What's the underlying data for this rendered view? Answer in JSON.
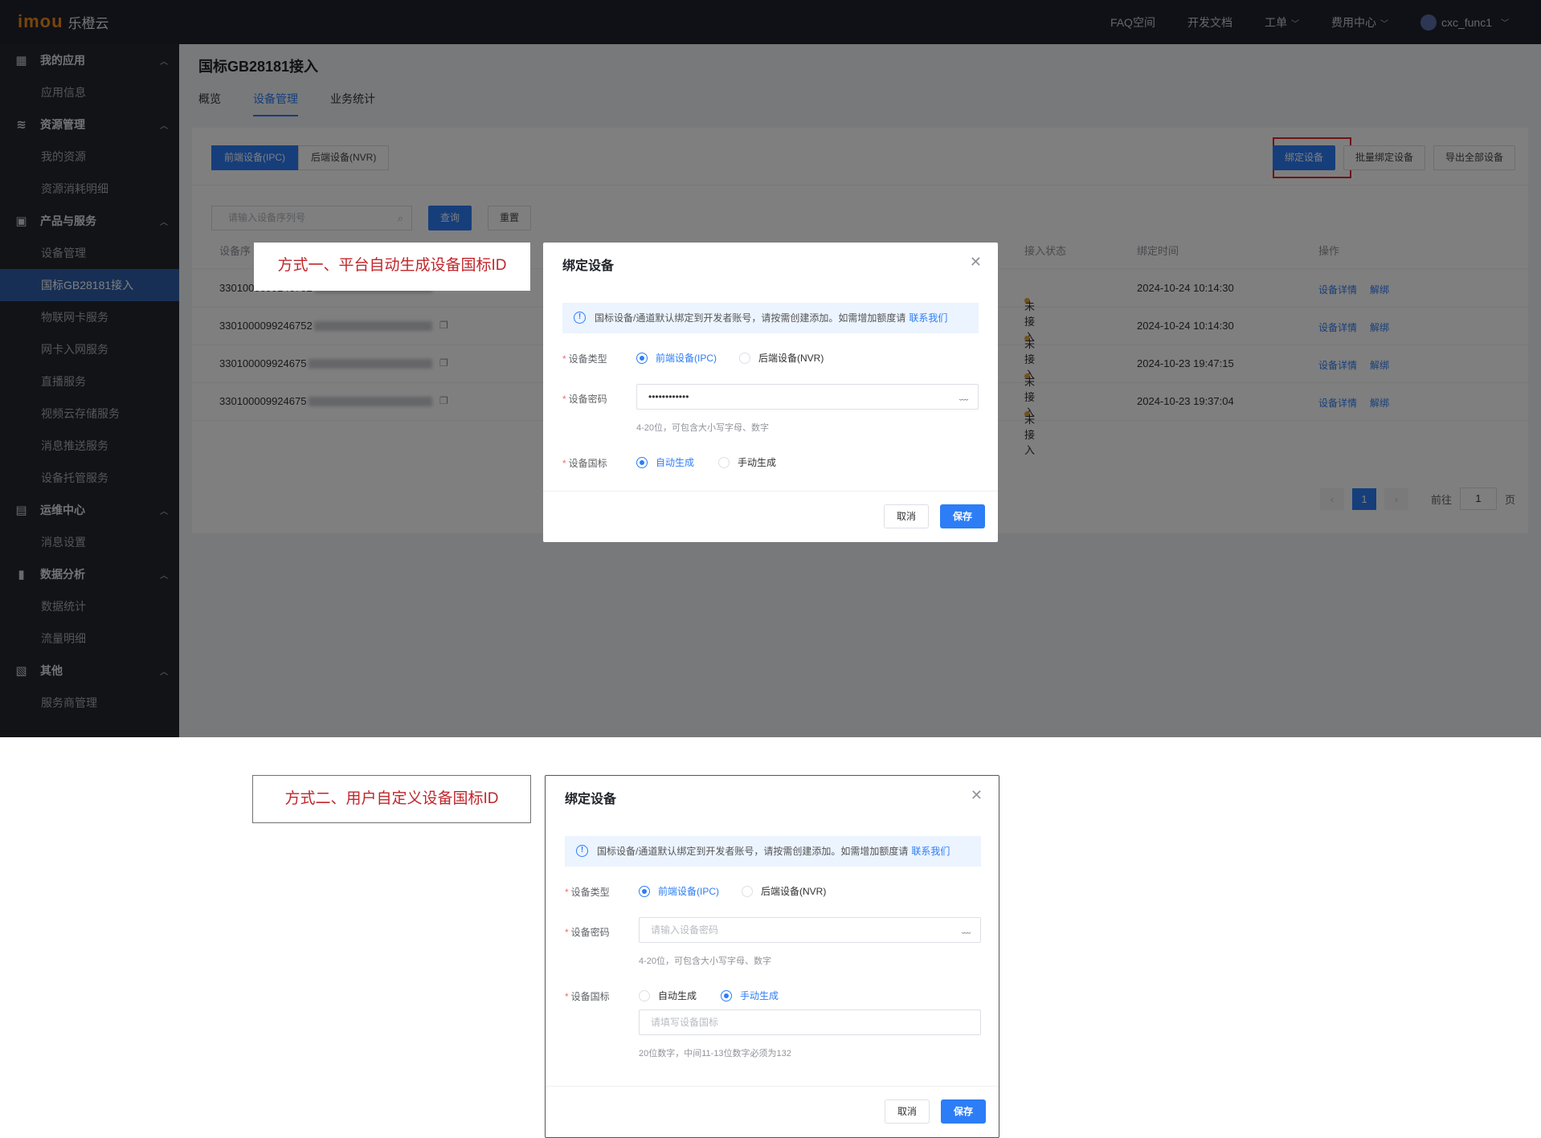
{
  "topbar": {
    "logo_mark": "imou",
    "logo_text": "乐橙云",
    "nav": [
      "FAQ空间",
      "开发文档",
      "工单",
      "费用中心"
    ],
    "username": "cxc_func1"
  },
  "sidebar": {
    "groups": [
      {
        "label": "我的应用",
        "icon": "grid-icon",
        "items": [
          "应用信息"
        ]
      },
      {
        "label": "资源管理",
        "icon": "layers-icon",
        "items": [
          "我的资源",
          "资源消耗明细"
        ]
      },
      {
        "label": "产品与服务",
        "icon": "camera-icon",
        "items": [
          "设备管理",
          "国标GB28181接入",
          "物联网卡服务",
          "网卡入网服务",
          "直播服务",
          "视频云存储服务",
          "消息推送服务",
          "设备托管服务"
        ]
      },
      {
        "label": "运维中心",
        "icon": "monitor-icon",
        "items": [
          "消息设置"
        ]
      },
      {
        "label": "数据分析",
        "icon": "bar-chart-icon",
        "items": [
          "数据统计",
          "流量明细"
        ]
      },
      {
        "label": "其他",
        "icon": "calendar-icon",
        "items": [
          "服务商管理"
        ]
      }
    ],
    "active_item": "国标GB28181接入"
  },
  "page": {
    "title": "国标GB28181接入",
    "tabs": [
      "概览",
      "设备管理",
      "业务统计"
    ],
    "active_tab": "设备管理"
  },
  "device_panel": {
    "segments": [
      "前端设备(IPC)",
      "后端设备(NVR)"
    ],
    "actions": [
      "绑定设备",
      "批量绑定设备",
      "导出全部设备"
    ],
    "search_placeholder": "请输入设备序列号",
    "query_label": "查询",
    "reset_label": "重置",
    "columns": {
      "serial": "设备序",
      "status": "接入状态",
      "bind_time": "绑定时间",
      "ops": "操作"
    },
    "rows": [
      {
        "serial": "3301000099246752",
        "status": "未接入",
        "bind_time": "2024-10-24 10:14:30",
        "detail": "设备详情",
        "unbind": "解绑"
      },
      {
        "serial": "3301000099246752",
        "status": "未接入",
        "bind_time": "2024-10-24 10:14:30",
        "detail": "设备详情",
        "unbind": "解绑"
      },
      {
        "serial": "330100009924675",
        "status": "未接入",
        "bind_time": "2024-10-23 19:47:15",
        "detail": "设备详情",
        "unbind": "解绑"
      },
      {
        "serial": "330100009924675",
        "status": "未接入",
        "bind_time": "2024-10-23 19:37:04",
        "detail": "设备详情",
        "unbind": "解绑"
      }
    ],
    "pagination": {
      "current_page": "1",
      "goto_label": "前往",
      "goto_value": "1",
      "page_suffix": "页"
    }
  },
  "modal_common": {
    "title": "绑定设备",
    "tip": "国标设备/通道默认绑定到开发者账号，请按需创建添加。如需增加额度请",
    "tip_link": "联系我们",
    "label_type": "设备类型",
    "type_ipc": "前端设备(IPC)",
    "type_nvr": "后端设备(NVR)",
    "label_password": "设备密码",
    "password_hint": "4-20位，可包含大小写字母、数字",
    "label_gb": "设备国标",
    "gb_auto": "自动生成",
    "gb_manual": "手动生成",
    "cancel": "取消",
    "save": "保存"
  },
  "modal_auto": {
    "callout": "方式一、平台自动生成设备国标ID",
    "password_value": "••••••••••••",
    "gb_selected": "自动生成"
  },
  "modal_manual": {
    "callout": "方式二、用户自定义设备国标ID",
    "password_placeholder": "请输入设备密码",
    "gb_selected": "手动生成",
    "gb_placeholder": "请填写设备国标",
    "gb_hint": "20位数字，中间11-13位数字必须为132"
  },
  "colors": {
    "accent": "#2d7df6",
    "topbar": "#20232c",
    "sidebar": "#23262f",
    "callout_text": "#c0262b",
    "highlight_border": "#e0262b"
  }
}
